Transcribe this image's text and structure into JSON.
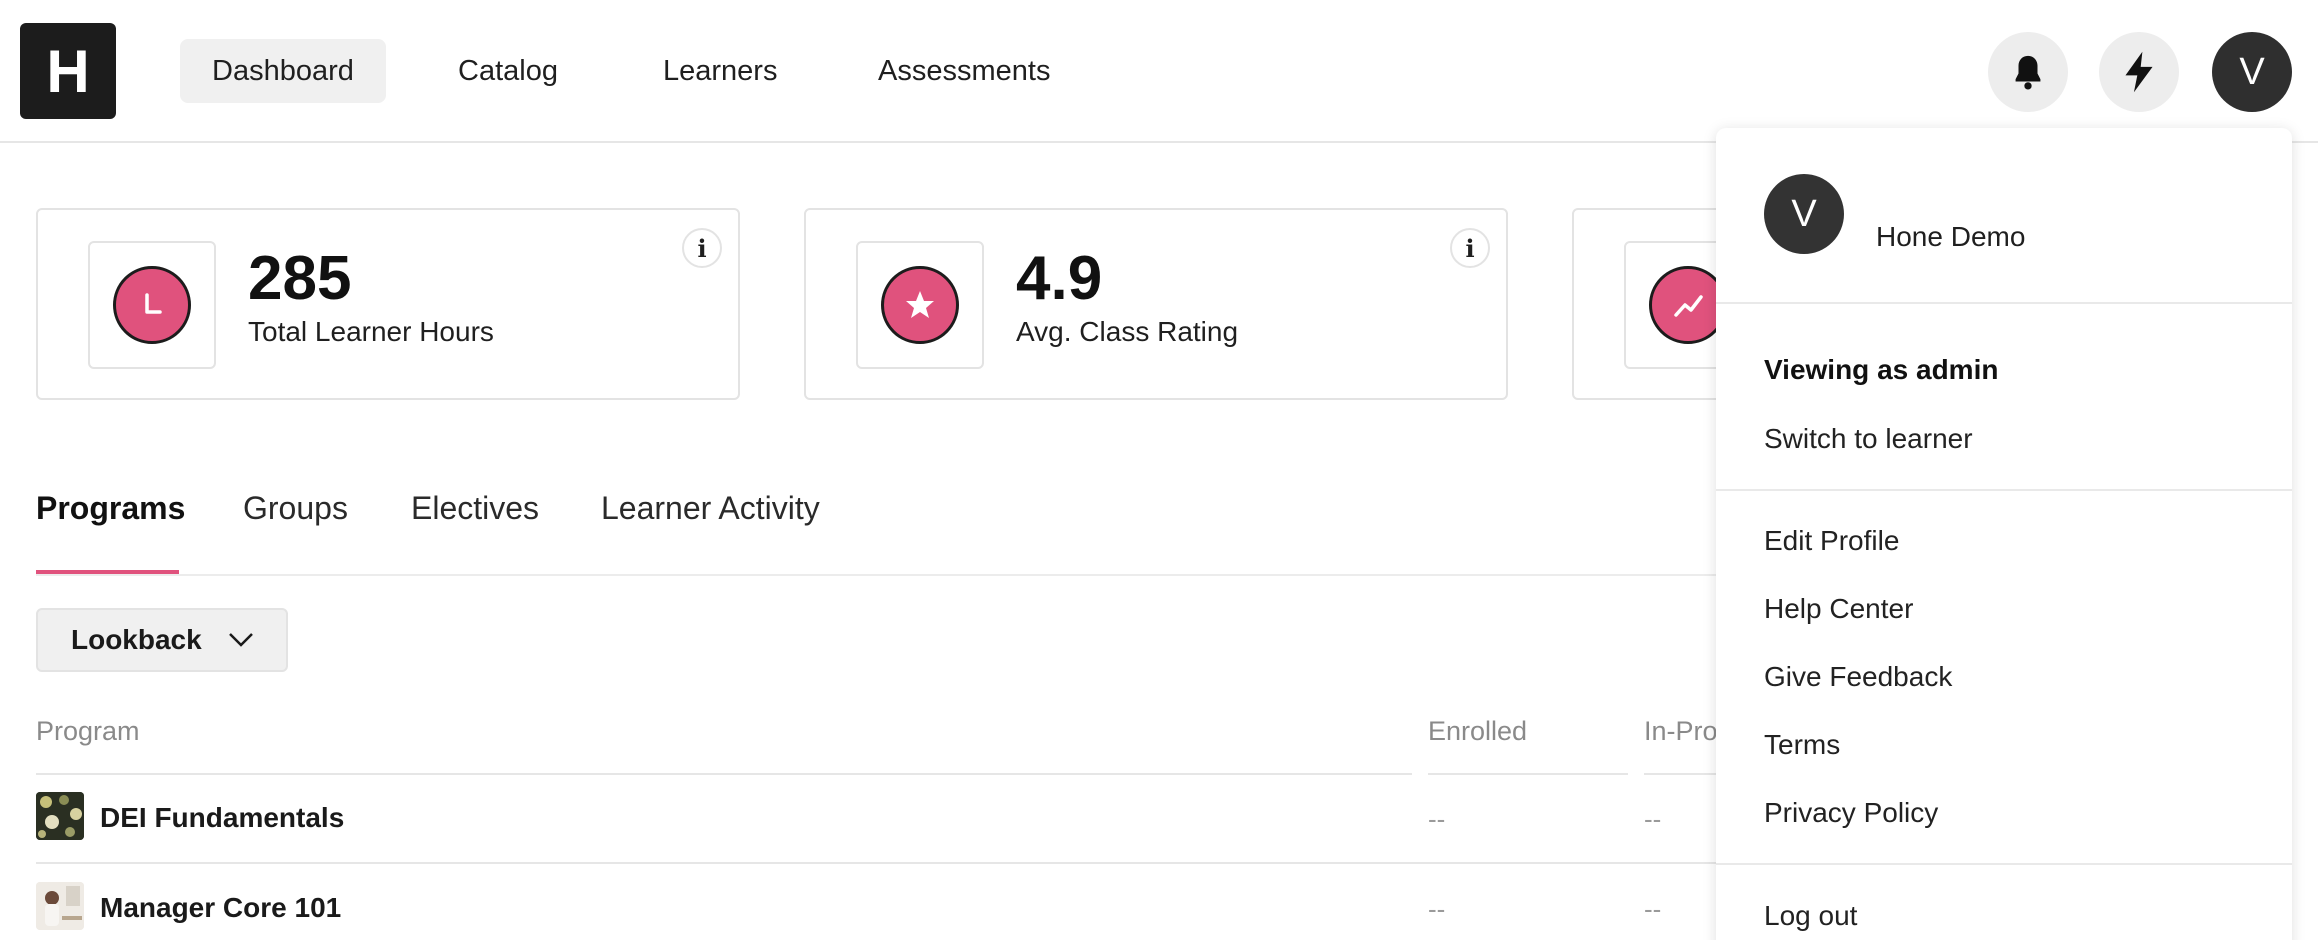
{
  "logo": {
    "letter": "H"
  },
  "nav": {
    "items": [
      {
        "label": "Dashboard",
        "active": true
      },
      {
        "label": "Catalog",
        "active": false
      },
      {
        "label": "Learners",
        "active": false
      },
      {
        "label": "Assessments",
        "active": false
      }
    ],
    "notifications_icon": "bell-icon",
    "quick_actions_icon": "lightning-icon",
    "avatar_letter": "V"
  },
  "stats": [
    {
      "value": "285",
      "label": "Total Learner Hours",
      "icon": "clock-icon"
    },
    {
      "value": "4.9",
      "label": "Avg. Class Rating",
      "icon": "star-icon"
    },
    {
      "value": "",
      "label": "",
      "icon": "trend-up-icon"
    }
  ],
  "tabs": [
    {
      "label": "Programs",
      "active": true
    },
    {
      "label": "Groups",
      "active": false
    },
    {
      "label": "Electives",
      "active": false
    },
    {
      "label": "Learner Activity",
      "active": false
    }
  ],
  "filter": {
    "lookback_label": "Lookback"
  },
  "table": {
    "columns": [
      "Program",
      "Enrolled",
      "In-Pro"
    ],
    "rows": [
      {
        "name": "DEI Fundamentals",
        "enrolled": "--",
        "in_progress": "--"
      },
      {
        "name": "Manager Core 101",
        "enrolled": "--",
        "in_progress": "--"
      }
    ]
  },
  "user_menu": {
    "avatar_letter": "V",
    "user_name": "Hone Demo",
    "role_heading": "Viewing as admin",
    "switch_label": "Switch to learner",
    "items": [
      "Edit Profile",
      "Help Center",
      "Give Feedback",
      "Terms",
      "Privacy Policy"
    ],
    "logout_label": "Log out"
  },
  "colors": {
    "accent": "#e0527d",
    "dark": "#1c1c1c"
  }
}
